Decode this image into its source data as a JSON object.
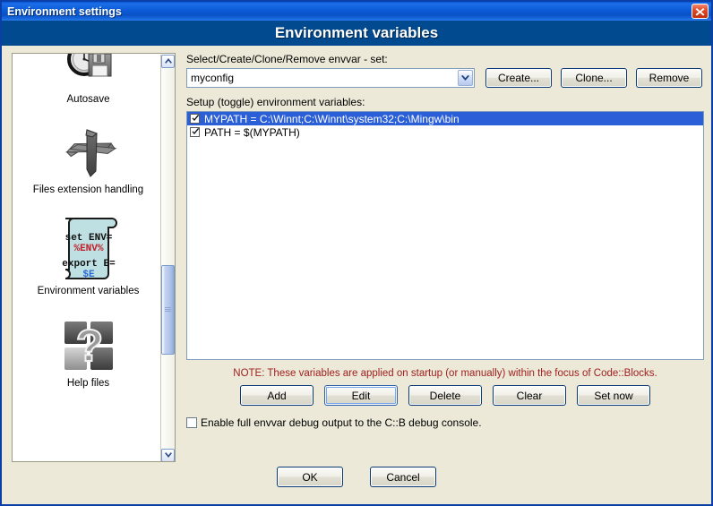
{
  "window": {
    "title": "Environment settings",
    "banner_title": "Environment variables",
    "close_icon": "close-icon",
    "accent_title_blue": "#0b5bd8",
    "banner_blue": "#014a8f",
    "face_color": "#ece9d8"
  },
  "sidebar": {
    "items": [
      {
        "label": "Autosave",
        "icon": "clock-floppy-icon"
      },
      {
        "label": "Files extension handling",
        "icon": "crossed-arrows-icon"
      },
      {
        "label": "Environment variables",
        "icon": "env-script-icon",
        "icon_text": {
          "line1": "set ENV=",
          "line2": "%ENV%",
          "line3": "export E=",
          "line4": "$E"
        }
      },
      {
        "label": "Help files",
        "icon": "question-cubes-icon"
      }
    ],
    "scrollbar": {
      "up_icon": "chevron-up-icon",
      "down_icon": "chevron-down-icon",
      "thumb_top_pct": 51,
      "thumb_height_pct": 22
    }
  },
  "main": {
    "envvar_set_label": "Select/Create/Clone/Remove envvar - set:",
    "combo": {
      "value": "myconfig",
      "arrow_icon": "chevron-down-icon"
    },
    "set_buttons": [
      {
        "label": "Create...",
        "name": "create-button"
      },
      {
        "label": "Clone...",
        "name": "clone-button"
      },
      {
        "label": "Remove",
        "name": "remove-button"
      }
    ],
    "list_label": "Setup (toggle) environment variables:",
    "variables": [
      {
        "checked": true,
        "text": "MYPATH = C:\\Winnt;C:\\Winnt\\system32;C:\\Mingw\\bin",
        "selected": true
      },
      {
        "checked": true,
        "text": "PATH = $(MYPATH)",
        "selected": false
      }
    ],
    "note": "NOTE: These variables are applied on startup (or manually) within the focus of Code::Blocks.",
    "note_color": "#a02020",
    "action_buttons": [
      {
        "label": "Add",
        "name": "add-button",
        "focused": false
      },
      {
        "label": "Edit",
        "name": "edit-button",
        "focused": true
      },
      {
        "label": "Delete",
        "name": "delete-button",
        "focused": false
      },
      {
        "label": "Clear",
        "name": "clear-button",
        "focused": false
      },
      {
        "label": "Set now",
        "name": "set-now-button",
        "focused": false
      }
    ],
    "debug_checkbox": {
      "checked": false,
      "label": "Enable full envvar debug output to the C::B debug console."
    }
  },
  "footer": {
    "ok_label": "OK",
    "cancel_label": "Cancel"
  }
}
